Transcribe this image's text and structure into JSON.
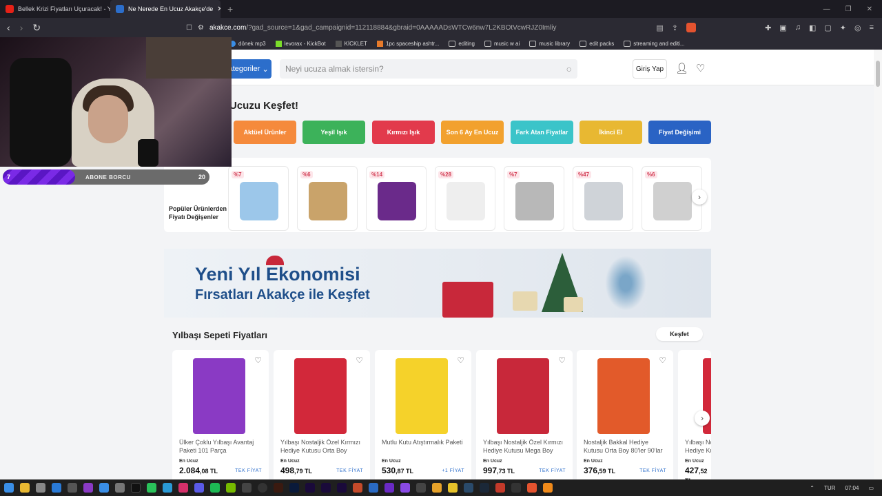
{
  "browser": {
    "tabs": [
      {
        "title": "Bellek Krizi Fiyatları Uçuracak! - YouTube",
        "active": false
      },
      {
        "title": "Ne Nerede En Ucuz Akakçe'de",
        "active": true
      }
    ],
    "url_host": "akakce.com",
    "url_rest": "/?gad_source=1&gad_campaignid=112118884&gbraid=0AAAAADsWTCw6nw7L2KBOtVcwRJZ0Imliy",
    "bookmarks": [
      "dönek mp3",
      "levorax - KickBot",
      "KİCKLET",
      "1pc spaceship ashtr...",
      "editing",
      "music w ai",
      "music library",
      "edit packs",
      "streaming and editi..."
    ]
  },
  "overlay": {
    "bar_left": "7",
    "bar_label": "ABONE BORCU",
    "bar_right": "20",
    "bar_progress": 0.35
  },
  "header": {
    "categories": "Kategoriler",
    "search_placeholder": "Neyi ucuza almak istersin?",
    "login": "Giriş Yap"
  },
  "discover": {
    "title": "Ucuzu Keşfet!",
    "chips": [
      {
        "label": "Aktüel Ürünler",
        "color": "#f58a3c"
      },
      {
        "label": "Yeşil Işık",
        "color": "#3cb25a"
      },
      {
        "label": "Kırmızı Işık",
        "color": "#e23a4c"
      },
      {
        "label": "Son 6 Ay En Ucuz",
        "color": "#f2a12e"
      },
      {
        "label": "Fark Atan Fiyatlar",
        "color": "#3bc4c9"
      },
      {
        "label": "İkinci El",
        "color": "#e8b832"
      },
      {
        "label": "Fiyat Değişimi",
        "color": "#2a63c4"
      }
    ]
  },
  "popular": {
    "label": "Popüler Ürünlerden Fiyatı Değişenler",
    "items": [
      {
        "pct": "%7",
        "color": "#9cc7ea"
      },
      {
        "pct": "%6",
        "color": "#c9a36a"
      },
      {
        "pct": "%14",
        "color": "#6a2a8a"
      },
      {
        "pct": "%28",
        "color": "#eeeeee"
      },
      {
        "pct": "%7",
        "color": "#b8b8b8"
      },
      {
        "pct": "%47",
        "color": "#cfd3d8"
      },
      {
        "pct": "%6",
        "color": "#d0d0d0"
      }
    ]
  },
  "banner": {
    "title": "Yeni Yıl Ekonomisi",
    "subtitle": "Fırsatları Akakçe ile Keşfet"
  },
  "sepet": {
    "title": "Yılbaşı Sepeti Fiyatları",
    "button": "Keşfet",
    "products": [
      {
        "name": "Ülker Çoklu Yılbaşı Avantaj Paketi 101 Parça",
        "en_ucuz": "En Ucuz",
        "price": "2.084",
        "cents": ",08 TL",
        "tag": "TEK FİYAT",
        "color": "#8a3ac4"
      },
      {
        "name": "Yılbaşı Nostaljik Özel Kırmızı Hediye Kutusu Orta Boy",
        "en_ucuz": "En Ucuz",
        "price": "498",
        "cents": ",79 TL",
        "tag": "TEK FİYAT",
        "color": "#d2283a"
      },
      {
        "name": "Mutlu Kutu Atıştırmalık Paketi",
        "en_ucuz": "En Ucuz",
        "price": "530",
        "cents": ",87 TL",
        "tag": "+1 FİYAT",
        "color": "#f5d22a"
      },
      {
        "name": "Yılbaşı Nostaljik Özel Kırmızı Hediye Kutusu Mega Boy",
        "en_ucuz": "En Ucuz",
        "price": "997",
        "cents": ",73 TL",
        "tag": "TEK FİYAT",
        "color": "#c8283a"
      },
      {
        "name": "Nostaljik Bakkal Hediye Kutusu Orta Boy 80'ler 90'lar",
        "en_ucuz": "En Ucuz",
        "price": "376",
        "cents": ",59 TL",
        "tag": "TEK FİYAT",
        "color": "#e25a2a"
      },
      {
        "name": "Yılbaşı Nostaljik Özel Kırmızı Hediye Kutusu",
        "en_ucuz": "En Ucuz",
        "price": "427",
        "cents": ",52 TL",
        "tag": "",
        "color": "#d2283a"
      }
    ]
  },
  "taskbar": {
    "lang": "TUR",
    "time": "07:04"
  }
}
